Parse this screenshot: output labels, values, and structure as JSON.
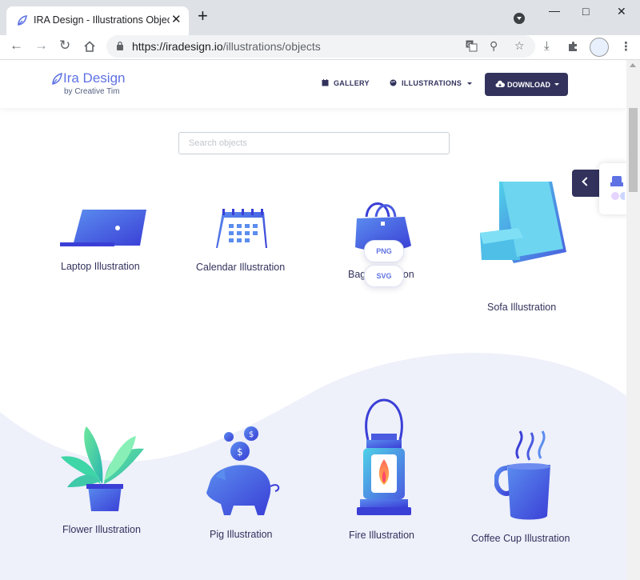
{
  "browser": {
    "tab_title": "IRA Design - Illustrations Objects",
    "tab_close": "✕",
    "new_tab": "+",
    "url_host": "https://iradesign.io",
    "url_path": "/illustrations/objects"
  },
  "site": {
    "logo_text": "Ira Design",
    "logo_sub": "by Creative Tim",
    "nav": {
      "gallery": "GALLERY",
      "illustrations": "ILLUSTRATIONS",
      "download": "DOWNLOAD"
    },
    "search_placeholder": "Search objects",
    "colors": {
      "primary": "#5e72e4",
      "dark": "#32325d",
      "wave": "#eef0fa"
    }
  },
  "items": [
    {
      "label": "Laptop Illustration",
      "icon": "laptop-icon"
    },
    {
      "label": "Calendar Illustration",
      "icon": "calendar-icon"
    },
    {
      "label": "Bag Illustration",
      "icon": "bag-icon"
    },
    {
      "label": "Sofa Illustration",
      "icon": "sofa-icon"
    },
    {
      "label": "Flower Illustration",
      "icon": "flower-icon"
    },
    {
      "label": "Pig Illustration",
      "icon": "pig-icon"
    },
    {
      "label": "Fire Illustration",
      "icon": "lantern-icon"
    },
    {
      "label": "Coffee Cup Illustration",
      "icon": "coffee-cup-icon"
    }
  ],
  "hover_buttons": {
    "png": "PNG",
    "svg": "SVG"
  }
}
